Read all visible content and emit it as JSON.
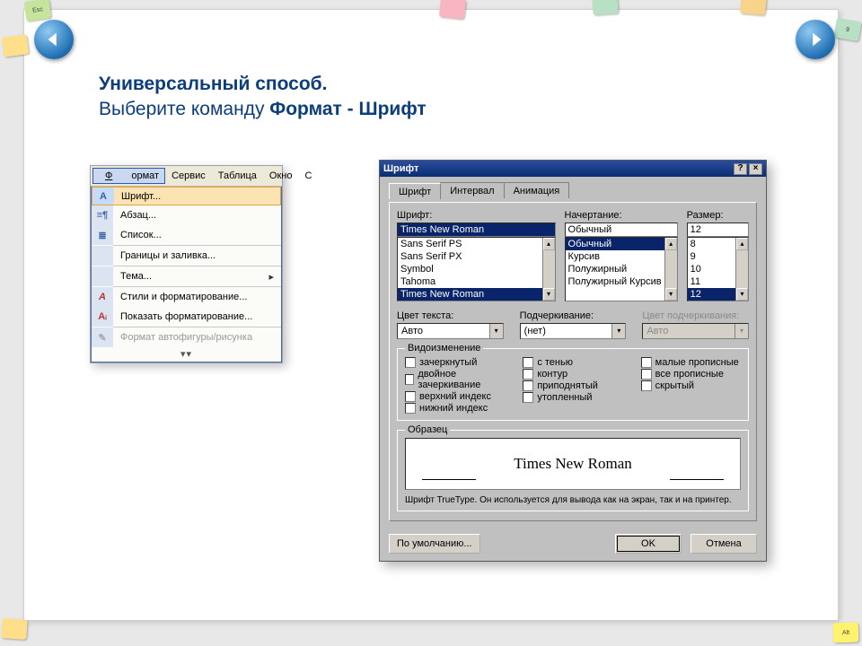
{
  "title": {
    "line1_bold": "Универсальный способ.",
    "line2_plain": "Выберите команду ",
    "line2_bold": "Формат - Шрифт"
  },
  "page_num": "9",
  "key_chips": {
    "esc": "Esc",
    "alt": "Alt"
  },
  "menu_bar": {
    "format": "Формат",
    "service": "Сервис",
    "table": "Таблица",
    "window": "Окно"
  },
  "format_menu": {
    "font": "Шрифт...",
    "paragraph": "Абзац...",
    "list": "Список...",
    "borders": "Границы и заливка...",
    "theme": "Тема...",
    "styles": "Стили и форматирование...",
    "reveal": "Показать форматирование...",
    "autoshape": "Формат автофигуры/рисунка"
  },
  "dialog": {
    "title": "Шрифт",
    "tabs": {
      "font": "Шрифт",
      "spacing": "Интервал",
      "anim": "Анимация"
    },
    "labels": {
      "font": "Шрифт:",
      "style": "Начертание:",
      "size": "Размер:",
      "textcolor": "Цвет текста:",
      "underline": "Подчеркивание:",
      "ulcolor": "Цвет подчеркивания:",
      "effects": "Видоизменение",
      "sample": "Образец"
    },
    "font_value": "Times New Roman",
    "font_list": [
      "Sans Serif PS",
      "Sans Serif PX",
      "Symbol",
      "Tahoma",
      "Times New Roman"
    ],
    "style_value": "Обычный",
    "style_list": [
      "Обычный",
      "Курсив",
      "Полужирный",
      "Полужирный Курсив"
    ],
    "size_value": "12",
    "size_list": [
      "8",
      "9",
      "10",
      "11",
      "12"
    ],
    "textcolor_value": "Авто",
    "underline_value": "(нет)",
    "ulcolor_value": "Авто",
    "effects": {
      "col1": [
        "зачеркнутый",
        "двойное зачеркивание",
        "верхний индекс",
        "нижний индекс"
      ],
      "col2": [
        "с тенью",
        "контур",
        "приподнятый",
        "утопленный"
      ],
      "col3": [
        "малые прописные",
        "все прописные",
        "скрытый"
      ]
    },
    "sample_text": "Times New Roman",
    "hint": "Шрифт TrueType. Он используется для вывода как на экран, так и на принтер.",
    "buttons": {
      "default": "По умолчанию...",
      "ok": "OK",
      "cancel": "Отмена"
    }
  }
}
